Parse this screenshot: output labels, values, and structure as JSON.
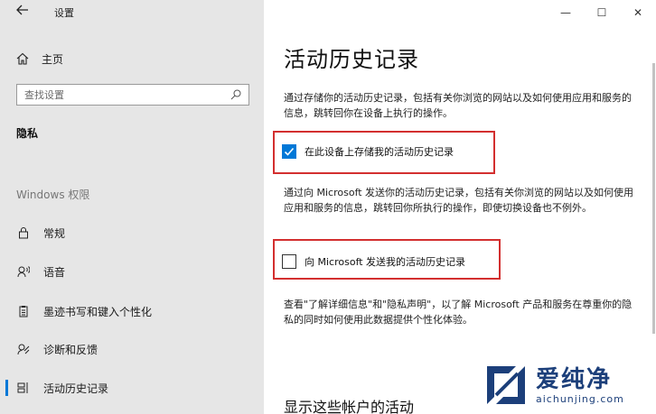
{
  "window": {
    "title": "设置",
    "controls": {
      "minimize": "—",
      "maximize": "☐",
      "close": "✕"
    }
  },
  "sidebar": {
    "home_label": "主页",
    "search_placeholder": "查找设置",
    "section_privacy": "隐私",
    "section_windows": "Windows 权限",
    "items": [
      {
        "label": "常规",
        "icon": "lock-icon"
      },
      {
        "label": "语音",
        "icon": "speech-icon"
      },
      {
        "label": "墨迹书写和键入个性化",
        "icon": "clipboard-icon"
      },
      {
        "label": "诊断和反馈",
        "icon": "feedback-icon"
      },
      {
        "label": "活动历史记录",
        "icon": "timeline-icon",
        "active": true
      }
    ]
  },
  "main": {
    "title": "活动历史记录",
    "desc1": "通过存储你的活动历史记录，包括有关你浏览的网站以及如何使用应用和服务的信息，跳转回你在设备上执行的操作。",
    "check1_label": "在此设备上存储我的活动历史记录",
    "check1_checked": true,
    "desc2": "通过向 Microsoft 发送你的活动历史记录，包括有关你浏览的网站以及如何使用应用和服务的信息，跳转回你所执行的操作，即使切换设备也不例外。",
    "check2_label": "向 Microsoft 发送我的活动历史记录",
    "check2_checked": false,
    "desc3": "查看\"了解详细信息\"和\"隐私声明\"，以了解 Microsoft 产品和服务在尊重你的隐私的同时如何使用此数据提供个性化体验。",
    "subtitle": "显示这些帐户的活动"
  },
  "watermark": {
    "big": "爱纯净",
    "small": "aichunjing.com"
  },
  "colors": {
    "accent": "#0078d7",
    "highlight": "#d32f2f",
    "sidebar_bg": "#e6e6e6",
    "watermark": "#1c3f7a"
  }
}
